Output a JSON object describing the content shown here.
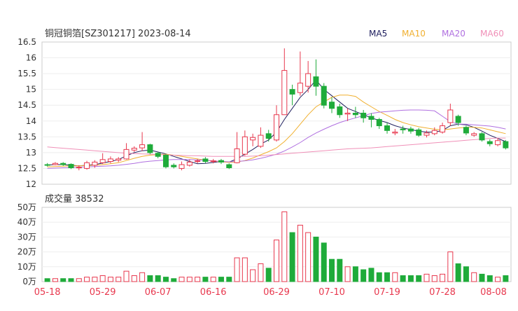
{
  "title": "铜冠铜箔[SZ301217] 2023-08-14",
  "legend": [
    {
      "label": "MA5",
      "color": "#20205f"
    },
    {
      "label": "MA10",
      "color": "#f0b030"
    },
    {
      "label": "MA20",
      "color": "#b070e0"
    },
    {
      "label": "MA60",
      "color": "#f090b8"
    }
  ],
  "colors": {
    "up": "#e8384e",
    "down": "#1fab3a",
    "axis": "#999999"
  },
  "volume_label": "成交量 38532",
  "chart_data": [
    {
      "type": "candlestick",
      "ylim": [
        12,
        16.5
      ],
      "yticks": [
        "16.5",
        "16",
        "15.5",
        "15",
        "14.5",
        "14",
        "13.5",
        "13",
        "12.5",
        "12"
      ],
      "xticks": [
        "05-18",
        "05-29",
        "06-07",
        "06-16",
        "06-29",
        "07-10",
        "07-19",
        "07-28",
        "08-08"
      ],
      "candles": [
        [
          12.62,
          12.6,
          12.67,
          12.56
        ],
        [
          12.62,
          12.66,
          12.7,
          12.6
        ],
        [
          12.66,
          12.62,
          12.7,
          12.58
        ],
        [
          12.63,
          12.52,
          12.66,
          12.48
        ],
        [
          12.52,
          12.54,
          12.6,
          12.44
        ],
        [
          12.5,
          12.68,
          12.74,
          12.46
        ],
        [
          12.6,
          12.7,
          12.76,
          12.52
        ],
        [
          12.68,
          12.78,
          12.98,
          12.64
        ],
        [
          12.72,
          12.8,
          12.88,
          12.66
        ],
        [
          12.76,
          12.8,
          12.86,
          12.7
        ],
        [
          12.8,
          13.1,
          13.3,
          12.78
        ],
        [
          13.08,
          13.14,
          13.2,
          13.02
        ],
        [
          13.15,
          13.25,
          13.65,
          13.05
        ],
        [
          13.25,
          13.0,
          13.28,
          12.95
        ],
        [
          12.98,
          12.88,
          13.02,
          12.82
        ],
        [
          12.92,
          12.55,
          12.95,
          12.5
        ],
        [
          12.6,
          12.55,
          12.66,
          12.5
        ],
        [
          12.5,
          12.62,
          12.72,
          12.44
        ],
        [
          12.6,
          12.7,
          12.78,
          12.56
        ],
        [
          12.72,
          12.74,
          12.8,
          12.66
        ],
        [
          12.8,
          12.72,
          12.86,
          12.66
        ],
        [
          12.72,
          12.74,
          12.8,
          12.66
        ],
        [
          12.75,
          12.7,
          12.8,
          12.64
        ],
        [
          12.62,
          12.52,
          12.66,
          12.48
        ],
        [
          12.68,
          13.12,
          13.65,
          12.66
        ],
        [
          12.95,
          13.5,
          13.7,
          12.9
        ],
        [
          13.4,
          13.48,
          13.6,
          13.2
        ],
        [
          13.2,
          13.55,
          13.8,
          13.15
        ],
        [
          13.6,
          13.45,
          13.72,
          13.35
        ],
        [
          13.4,
          14.2,
          14.5,
          13.35
        ],
        [
          14.2,
          15.6,
          16.3,
          14.2
        ],
        [
          15.0,
          14.85,
          15.15,
          14.5
        ],
        [
          14.9,
          15.2,
          16.2,
          14.8
        ],
        [
          15.1,
          15.5,
          15.9,
          14.9
        ],
        [
          15.4,
          15.1,
          15.95,
          14.8
        ],
        [
          15.1,
          14.5,
          15.2,
          14.4
        ],
        [
          14.6,
          14.4,
          14.75,
          14.25
        ],
        [
          14.45,
          14.2,
          14.55,
          14.1
        ],
        [
          14.22,
          14.25,
          14.4,
          14.0
        ],
        [
          14.25,
          14.2,
          14.45,
          14.1
        ],
        [
          14.25,
          14.1,
          14.35,
          13.95
        ],
        [
          14.15,
          14.05,
          14.25,
          13.8
        ],
        [
          14.05,
          13.85,
          14.1,
          13.75
        ],
        [
          13.85,
          13.7,
          13.95,
          13.6
        ],
        [
          13.62,
          13.65,
          13.75,
          13.55
        ],
        [
          13.75,
          13.72,
          13.85,
          13.6
        ],
        [
          13.75,
          13.68,
          13.82,
          13.6
        ],
        [
          13.72,
          13.55,
          13.78,
          13.5
        ],
        [
          13.55,
          13.62,
          13.7,
          13.48
        ],
        [
          13.6,
          13.7,
          13.8,
          13.55
        ],
        [
          13.65,
          13.85,
          13.95,
          13.6
        ],
        [
          13.95,
          14.35,
          14.55,
          13.85
        ],
        [
          14.15,
          13.95,
          14.2,
          13.85
        ],
        [
          13.8,
          13.62,
          13.85,
          13.55
        ],
        [
          13.55,
          13.6,
          13.65,
          13.5
        ],
        [
          13.6,
          13.4,
          13.65,
          13.35
        ],
        [
          13.35,
          13.28,
          13.42,
          13.2
        ],
        [
          13.25,
          13.38,
          13.45,
          13.2
        ],
        [
          13.35,
          13.15,
          13.4,
          13.1
        ]
      ],
      "ma": [
        {
          "name": "MA5",
          "values": [
            12.61,
            12.62,
            12.62,
            12.6,
            12.58,
            12.6,
            12.62,
            12.67,
            12.72,
            12.78,
            12.9,
            13.0,
            13.06,
            13.08,
            13.02,
            12.96,
            12.88,
            12.8,
            12.72,
            12.65,
            12.66,
            12.69,
            12.72,
            12.7,
            12.8,
            12.95,
            13.1,
            13.27,
            13.4,
            13.65,
            14.05,
            14.4,
            14.75,
            15.0,
            15.3,
            15.0,
            14.8,
            14.6,
            14.4,
            14.3,
            14.2,
            14.1,
            14.02,
            13.95,
            13.85,
            13.78,
            13.73,
            13.68,
            13.65,
            13.65,
            13.7,
            13.85,
            13.9,
            13.88,
            13.8,
            13.68,
            13.55,
            13.45,
            13.35
          ]
        },
        {
          "name": "MA10",
          "values": [
            12.55,
            12.56,
            12.57,
            12.58,
            12.58,
            12.59,
            12.6,
            12.62,
            12.65,
            12.68,
            12.75,
            12.82,
            12.88,
            12.92,
            12.94,
            12.95,
            12.92,
            12.88,
            12.84,
            12.8,
            12.76,
            12.73,
            12.71,
            12.69,
            12.7,
            12.75,
            12.83,
            12.93,
            13.03,
            13.15,
            13.35,
            13.6,
            13.9,
            14.2,
            14.45,
            14.6,
            14.75,
            14.82,
            14.82,
            14.78,
            14.6,
            14.45,
            14.3,
            14.18,
            14.05,
            13.95,
            13.88,
            13.82,
            13.78,
            13.74,
            13.72,
            13.75,
            13.78,
            13.8,
            13.8,
            13.78,
            13.72,
            13.66,
            13.6
          ]
        },
        {
          "name": "MA20",
          "values": [
            12.5,
            12.51,
            12.52,
            12.53,
            12.54,
            12.55,
            12.56,
            12.57,
            12.58,
            12.6,
            12.63,
            12.66,
            12.7,
            12.73,
            12.75,
            12.77,
            12.78,
            12.78,
            12.78,
            12.77,
            12.76,
            12.74,
            12.72,
            12.71,
            12.72,
            12.74,
            12.77,
            12.82,
            12.88,
            12.95,
            13.05,
            13.18,
            13.32,
            13.48,
            13.62,
            13.74,
            13.85,
            13.95,
            14.03,
            14.1,
            14.17,
            14.24,
            14.28,
            14.3,
            14.32,
            14.34,
            14.35,
            14.35,
            14.34,
            14.32,
            14.15,
            13.98,
            13.9,
            13.9,
            13.88,
            13.86,
            13.84,
            13.8,
            13.75
          ]
        },
        {
          "name": "MA60",
          "values": [
            13.18,
            13.16,
            13.14,
            13.12,
            13.1,
            13.08,
            13.06,
            13.04,
            13.02,
            13.0,
            12.98,
            12.97,
            12.96,
            12.95,
            12.94,
            12.93,
            12.92,
            12.91,
            12.9,
            12.9,
            12.89,
            12.88,
            12.88,
            12.88,
            12.88,
            12.88,
            12.89,
            12.9,
            12.92,
            12.94,
            12.96,
            12.98,
            13.0,
            13.02,
            13.04,
            13.06,
            13.08,
            13.1,
            13.12,
            13.13,
            13.14,
            13.15,
            13.17,
            13.19,
            13.21,
            13.23,
            13.25,
            13.27,
            13.29,
            13.31,
            13.33,
            13.35,
            13.37,
            13.39,
            13.41,
            13.43,
            13.45,
            13.46,
            13.46
          ]
        }
      ]
    },
    {
      "type": "bar",
      "title": "成交量",
      "ylim": [
        0,
        50
      ],
      "yticks": [
        "50万",
        "40万",
        "30万",
        "20万",
        "10万",
        "0万"
      ],
      "values": [
        2,
        2,
        2,
        2,
        2,
        3,
        3,
        4,
        3,
        3,
        7,
        4,
        6,
        4,
        4,
        3,
        2,
        3,
        3,
        3,
        3,
        3,
        3,
        3,
        16,
        16,
        8,
        12,
        9,
        28,
        47,
        33,
        38,
        33,
        30,
        26,
        15,
        15,
        10,
        10,
        8,
        9,
        6,
        6,
        6,
        4,
        4,
        4,
        5,
        4,
        5,
        20,
        12,
        10,
        6,
        5,
        4,
        3,
        4
      ]
    }
  ]
}
